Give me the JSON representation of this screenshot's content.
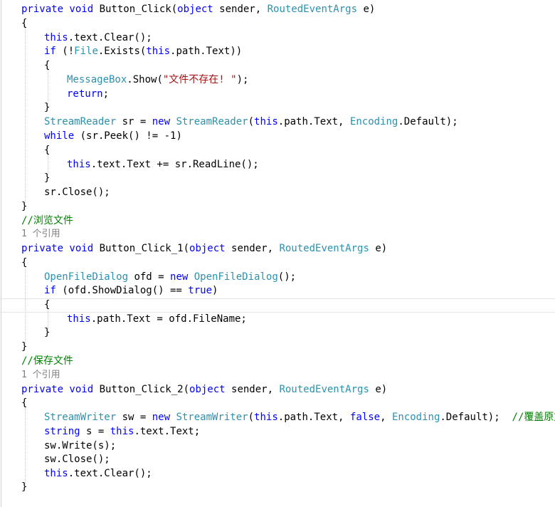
{
  "code_lines": [
    [
      {
        "t": "private void ",
        "c": "kw"
      },
      {
        "t": "Button_Click(",
        "c": "pl"
      },
      {
        "t": "object",
        "c": "kw"
      },
      {
        "t": " sender, ",
        "c": "pl"
      },
      {
        "t": "RoutedEventArgs",
        "c": "ty"
      },
      {
        "t": " e)",
        "c": "pl"
      }
    ],
    [
      {
        "t": "{",
        "c": "pl"
      }
    ],
    [
      {
        "t": "this",
        "c": "kw"
      },
      {
        "t": ".text.Clear();",
        "c": "pl"
      }
    ],
    [
      {
        "t": "if",
        "c": "kw"
      },
      {
        "t": " (!",
        "c": "pl"
      },
      {
        "t": "File",
        "c": "ty"
      },
      {
        "t": ".Exists(",
        "c": "pl"
      },
      {
        "t": "this",
        "c": "kw"
      },
      {
        "t": ".path.Text))",
        "c": "pl"
      }
    ],
    [
      {
        "t": "{",
        "c": "pl"
      }
    ],
    [
      {
        "t": "MessageBox",
        "c": "ty"
      },
      {
        "t": ".Show(",
        "c": "pl"
      },
      {
        "t": "\"文件不存在! \"",
        "c": "str"
      },
      {
        "t": ");",
        "c": "pl"
      }
    ],
    [
      {
        "t": "return",
        "c": "kw"
      },
      {
        "t": ";",
        "c": "pl"
      }
    ],
    [
      {
        "t": "}",
        "c": "pl"
      }
    ],
    [
      {
        "t": "StreamReader",
        "c": "ty"
      },
      {
        "t": " sr = ",
        "c": "pl"
      },
      {
        "t": "new ",
        "c": "kw"
      },
      {
        "t": "StreamReader",
        "c": "ty"
      },
      {
        "t": "(",
        "c": "pl"
      },
      {
        "t": "this",
        "c": "kw"
      },
      {
        "t": ".path.Text, ",
        "c": "pl"
      },
      {
        "t": "Encoding",
        "c": "ty"
      },
      {
        "t": ".Default);",
        "c": "pl"
      }
    ],
    [
      {
        "t": "while",
        "c": "kw"
      },
      {
        "t": " (sr.Peek() != -1)",
        "c": "pl"
      }
    ],
    [
      {
        "t": "{",
        "c": "pl"
      }
    ],
    [
      {
        "t": "this",
        "c": "kw"
      },
      {
        "t": ".text.Text += sr.ReadLine();",
        "c": "pl"
      }
    ],
    [
      {
        "t": "}",
        "c": "pl"
      }
    ],
    [
      {
        "t": "sr.Close();",
        "c": "pl"
      }
    ],
    [
      {
        "t": "}",
        "c": "pl"
      }
    ],
    [
      {
        "t": "//浏览文件",
        "c": "cm"
      }
    ],
    [
      {
        "t": "1 个引用",
        "c": "ref"
      }
    ],
    [
      {
        "t": "private void ",
        "c": "kw"
      },
      {
        "t": "Button_Click_1(",
        "c": "pl"
      },
      {
        "t": "object",
        "c": "kw"
      },
      {
        "t": " sender, ",
        "c": "pl"
      },
      {
        "t": "RoutedEventArgs",
        "c": "ty"
      },
      {
        "t": " e)",
        "c": "pl"
      }
    ],
    [
      {
        "t": "{",
        "c": "pl"
      }
    ],
    [
      {
        "t": "OpenFileDialog",
        "c": "ty"
      },
      {
        "t": " ofd = ",
        "c": "pl"
      },
      {
        "t": "new ",
        "c": "kw"
      },
      {
        "t": "OpenFileDialog",
        "c": "ty"
      },
      {
        "t": "();",
        "c": "pl"
      }
    ],
    [
      {
        "t": "if",
        "c": "kw"
      },
      {
        "t": " (ofd.ShowDialog() == ",
        "c": "pl"
      },
      {
        "t": "true",
        "c": "kw"
      },
      {
        "t": ")",
        "c": "pl"
      }
    ],
    [
      {
        "t": "{",
        "c": "pl"
      }
    ],
    [
      {
        "t": "this",
        "c": "kw"
      },
      {
        "t": ".path.Text = ofd.FileName;",
        "c": "pl"
      }
    ],
    [
      {
        "t": "}",
        "c": "pl"
      }
    ],
    [
      {
        "t": "}",
        "c": "pl"
      }
    ],
    [
      {
        "t": "//保存文件",
        "c": "cm"
      }
    ],
    [
      {
        "t": "1 个引用",
        "c": "ref"
      }
    ],
    [
      {
        "t": "private void ",
        "c": "kw"
      },
      {
        "t": "Button_Click_2(",
        "c": "pl"
      },
      {
        "t": "object",
        "c": "kw"
      },
      {
        "t": " sender, ",
        "c": "pl"
      },
      {
        "t": "RoutedEventArgs",
        "c": "ty"
      },
      {
        "t": " e)",
        "c": "pl"
      }
    ],
    [
      {
        "t": "{",
        "c": "pl"
      }
    ],
    [
      {
        "t": "StreamWriter",
        "c": "ty"
      },
      {
        "t": " sw = ",
        "c": "pl"
      },
      {
        "t": "new ",
        "c": "kw"
      },
      {
        "t": "StreamWriter",
        "c": "ty"
      },
      {
        "t": "(",
        "c": "pl"
      },
      {
        "t": "this",
        "c": "kw"
      },
      {
        "t": ".path.Text, ",
        "c": "pl"
      },
      {
        "t": "false",
        "c": "kw"
      },
      {
        "t": ", ",
        "c": "pl"
      },
      {
        "t": "Encoding",
        "c": "ty"
      },
      {
        "t": ".Default);  ",
        "c": "pl"
      },
      {
        "t": "//覆盖原文件",
        "c": "cm"
      }
    ],
    [
      {
        "t": "string",
        "c": "kw"
      },
      {
        "t": " s = ",
        "c": "pl"
      },
      {
        "t": "this",
        "c": "kw"
      },
      {
        "t": ".text.Text;",
        "c": "pl"
      }
    ],
    [
      {
        "t": "sw.Write(s);",
        "c": "pl"
      }
    ],
    [
      {
        "t": "sw.Close();",
        "c": "pl"
      }
    ],
    [
      {
        "t": "this",
        "c": "kw"
      },
      {
        "t": ".text.Clear();",
        "c": "pl"
      }
    ],
    [
      {
        "t": "}",
        "c": "pl"
      }
    ]
  ],
  "colors": {
    "keyword": "#0000ff",
    "type": "#2b91af",
    "string": "#a31515",
    "comment": "#008000",
    "codelens": "#808080"
  }
}
